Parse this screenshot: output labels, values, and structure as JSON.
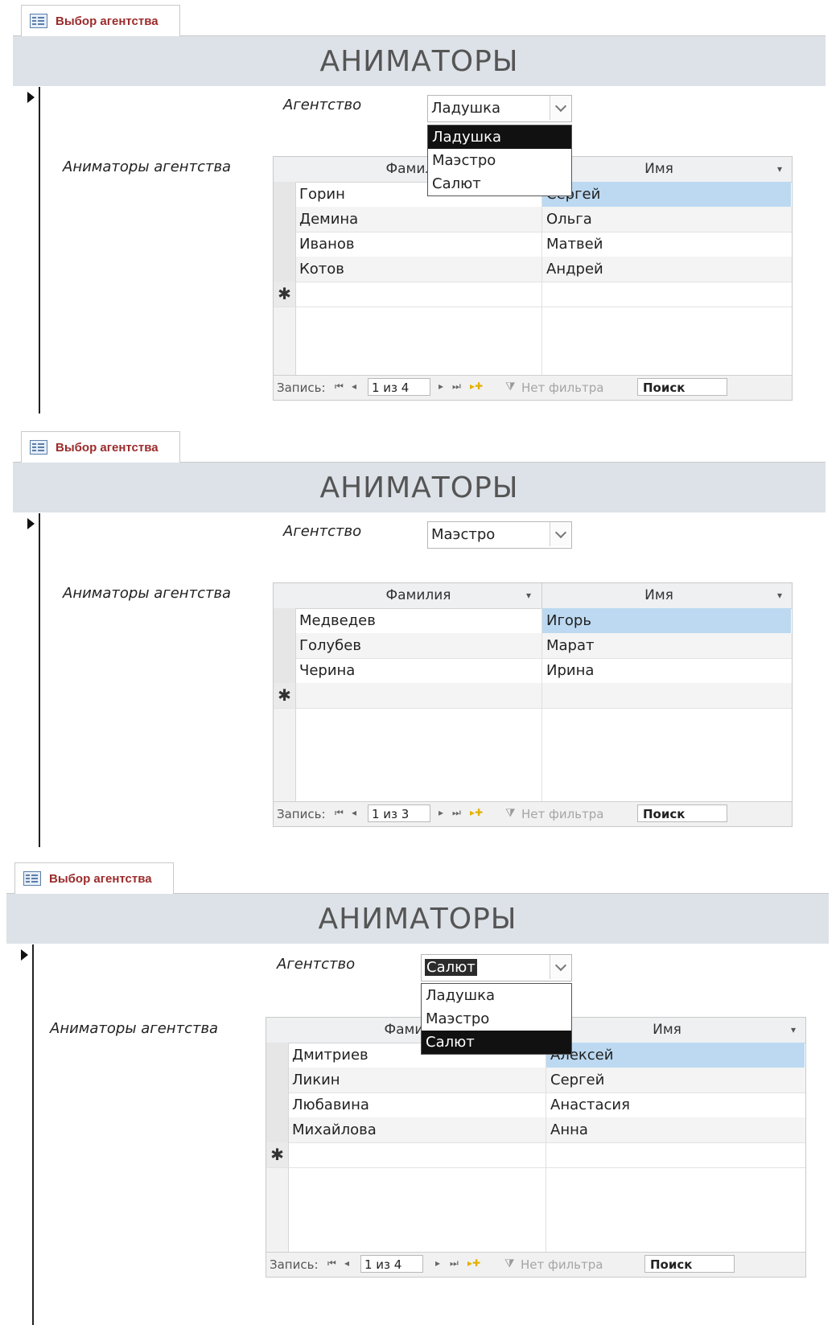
{
  "panels": [
    {
      "tab_label": "Выбор агентства",
      "header_title": "АНИМАТОРЫ",
      "agency_label": "Агентство",
      "combo_value": "Ладушка",
      "combo_value_selected": false,
      "dropdown": [
        "Ладушка",
        "Маэстро",
        "Салют"
      ],
      "dropdown_selected": 0,
      "dropdown_open": true,
      "subform_label": "Аниматоры агентства",
      "columns": [
        "Фамилия",
        "Имя"
      ],
      "rows": [
        {
          "last": "Горин",
          "first": "Сергей"
        },
        {
          "last": "Демина",
          "first": "Ольга"
        },
        {
          "last": "Иванов",
          "first": "Матвей"
        },
        {
          "last": "Котов",
          "first": "Андрей"
        }
      ],
      "nav": {
        "records_label": "Запись:",
        "record_position": "1 из 4",
        "filter": "Нет фильтра",
        "search": "Поиск"
      }
    },
    {
      "tab_label": "Выбор агентства",
      "header_title": "АНИМАТОРЫ",
      "agency_label": "Агентство",
      "combo_value": "Маэстро",
      "combo_value_selected": false,
      "dropdown": [],
      "dropdown_selected": -1,
      "dropdown_open": false,
      "subform_label": "Аниматоры агентства",
      "columns": [
        "Фамилия",
        "Имя"
      ],
      "rows": [
        {
          "last": "Медведев",
          "first": "Игорь"
        },
        {
          "last": "Голубев",
          "first": "Марат"
        },
        {
          "last": "Черина",
          "first": "Ирина"
        }
      ],
      "nav": {
        "records_label": "Запись:",
        "record_position": "1 из 3",
        "filter": "Нет фильтра",
        "search": "Поиск"
      }
    },
    {
      "tab_label": "Выбор агентства",
      "header_title": "АНИМАТОРЫ",
      "agency_label": "Агентство",
      "combo_value": "Салют",
      "combo_value_selected": true,
      "dropdown": [
        "Ладушка",
        "Маэстро",
        "Салют"
      ],
      "dropdown_selected": 2,
      "dropdown_open": true,
      "subform_label": "Аниматоры агентства",
      "columns": [
        "Фамилия",
        "Имя"
      ],
      "rows": [
        {
          "last": "Дмитриев",
          "first": "Алексей"
        },
        {
          "last": "Ликин",
          "first": "Сергей"
        },
        {
          "last": "Любавина",
          "first": "Анастасия"
        },
        {
          "last": "Михайлова",
          "first": "Анна"
        }
      ],
      "nav": {
        "records_label": "Запись:",
        "record_position": "1 из 4",
        "filter": "Нет фильтра",
        "search": "Поиск"
      }
    }
  ]
}
